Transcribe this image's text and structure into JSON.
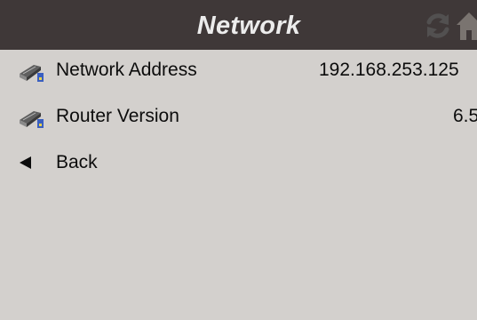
{
  "header": {
    "title": "Network",
    "bg_color": "#3f3838",
    "icons": [
      "refresh-icon",
      "home-icon"
    ]
  },
  "items": [
    {
      "label": "Network Address",
      "value": "192.168.253.125",
      "icon": "network-adapter-icon"
    },
    {
      "label": "Router Version",
      "value": "6.5",
      "icon": "network-adapter-icon"
    }
  ],
  "back": {
    "label": "Back",
    "icon": "back-arrow-icon"
  },
  "colors": {
    "background": "#d3d0cd",
    "text": "#0c0c0c",
    "header_text": "#ececec"
  }
}
